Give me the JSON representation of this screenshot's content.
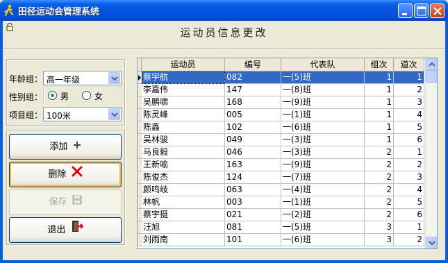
{
  "window": {
    "title": "田径运动会管理系统"
  },
  "heading": "运动员信息更改",
  "filters": {
    "age_label": "年龄组：",
    "age_value": "高一年级",
    "gender_label": "性别组：",
    "gender_male": "男",
    "gender_female": "女",
    "gender_selected": "男",
    "event_label": "项目组：",
    "event_value": "100米"
  },
  "buttons": {
    "add": "添加",
    "delete": "删除",
    "save": "保存",
    "exit": "退出"
  },
  "table": {
    "columns": [
      "运动员",
      "编号",
      "代表队",
      "组次",
      "道次"
    ],
    "rows": [
      [
        "蔡宇航",
        "082",
        "一(5)班",
        "1",
        "1"
      ],
      [
        "李嘉伟",
        "147",
        "一(8)班",
        "1",
        "2"
      ],
      [
        "吴鹏啸",
        "168",
        "一(9)班",
        "1",
        "3"
      ],
      [
        "陈灵峰",
        "005",
        "一(1)班",
        "1",
        "4"
      ],
      [
        "陈鑫",
        "102",
        "一(6)班",
        "1",
        "5"
      ],
      [
        "吴林骏",
        "049",
        "一(3)班",
        "1",
        "6"
      ],
      [
        "马良毅",
        "046",
        "一(3)班",
        "2",
        "1"
      ],
      [
        "王新喻",
        "163",
        "一(9)班",
        "2",
        "2"
      ],
      [
        "陈俊杰",
        "124",
        "一(7)班",
        "2",
        "3"
      ],
      [
        "颜鸣岐",
        "063",
        "一(4)班",
        "2",
        "4"
      ],
      [
        "林帆",
        "003",
        "一(1)班",
        "2",
        "5"
      ],
      [
        "蔡宇挺",
        "021",
        "一(2)班",
        "2",
        "6"
      ],
      [
        "汪旭",
        "081",
        "一(5)班",
        "3",
        "1"
      ],
      [
        "刘雨南",
        "101",
        "一(6)班",
        "3",
        "2"
      ]
    ]
  },
  "colors": {
    "selection": "#316ac5",
    "titlebar": "#0352d9"
  },
  "icons": {
    "app": "runner-icon",
    "lock": "lock-icon",
    "add": "plus-icon",
    "delete": "red-x-icon",
    "save": "floppy-disk-icon",
    "exit": "exit-door-icon"
  }
}
